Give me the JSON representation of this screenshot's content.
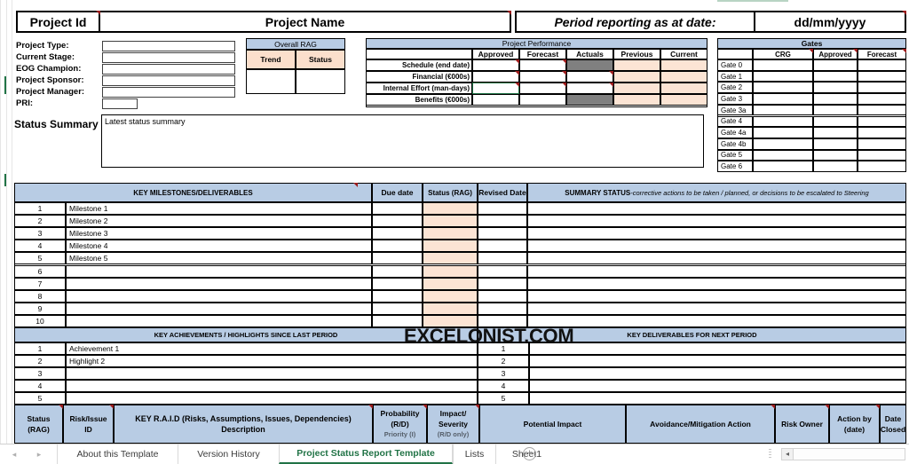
{
  "header": {
    "project_id": "Project Id",
    "project_name": "Project Name",
    "period_label": "Period reporting as at date:",
    "period_value": "dd/mm/yyyy"
  },
  "form": {
    "fields": [
      {
        "label": "Project Type:",
        "value": ""
      },
      {
        "label": "Current Stage:",
        "value": ""
      },
      {
        "label": "EOG Champion:",
        "value": ""
      },
      {
        "label": "Project Sponsor:",
        "value": ""
      },
      {
        "label": "Project Manager:",
        "value": ""
      },
      {
        "label": "PRI:",
        "value": ""
      }
    ]
  },
  "overall_rag": {
    "title": "Overall RAG",
    "columns": [
      "Trend",
      "Status"
    ],
    "values": [
      "",
      ""
    ]
  },
  "project_performance": {
    "title": "Project Performance",
    "columns": [
      "",
      "Approved",
      "Forecast",
      "Actuals",
      "Previous",
      "Current"
    ],
    "rows": [
      {
        "label": "Schedule (end date)",
        "approved": "",
        "forecast": "",
        "actuals": "",
        "previous": "",
        "current": ""
      },
      {
        "label": "Financial (€000s)",
        "approved": "",
        "forecast": "",
        "actuals": "",
        "previous": "",
        "current": ""
      },
      {
        "label": "Internal Effort (man-days)",
        "approved": "",
        "forecast": "",
        "actuals": "",
        "previous": "",
        "current": ""
      },
      {
        "label": "Benefits (€000s)",
        "approved": "",
        "forecast": "",
        "actuals": "",
        "previous": "",
        "current": ""
      }
    ]
  },
  "gates": {
    "title": "Gates",
    "columns": [
      "",
      "CRG",
      "Approved",
      "Forecast"
    ],
    "rows": [
      {
        "label": "Gate 0",
        "crg": "",
        "approved": "",
        "forecast": ""
      },
      {
        "label": "Gate 1",
        "crg": "",
        "approved": "",
        "forecast": ""
      },
      {
        "label": "Gate 2",
        "crg": "",
        "approved": "",
        "forecast": ""
      },
      {
        "label": "Gate 3",
        "crg": "",
        "approved": "",
        "forecast": ""
      },
      {
        "label": "Gate 3a",
        "crg": "",
        "approved": "",
        "forecast": ""
      },
      {
        "label": "Gate 4",
        "crg": "",
        "approved": "",
        "forecast": ""
      },
      {
        "label": "Gate 4a",
        "crg": "",
        "approved": "",
        "forecast": ""
      },
      {
        "label": "Gate 4b",
        "crg": "",
        "approved": "",
        "forecast": ""
      },
      {
        "label": "Gate 5",
        "crg": "",
        "approved": "",
        "forecast": ""
      },
      {
        "label": "Gate 6",
        "crg": "",
        "approved": "",
        "forecast": ""
      }
    ]
  },
  "status_summary": {
    "label": "Status Summary",
    "value": "Latest status summary"
  },
  "milestones": {
    "title": "KEY MILESTONES/DELIVERABLES",
    "col_due": "Due date",
    "col_status": "Status (RAG)",
    "col_revised": "Revised Date",
    "col_summary_bold": "SUMMARY STATUS",
    "col_summary_italic": "-corrective actions to be taken / planned, or decisions to be escalated to Steering",
    "rows": [
      {
        "n": "1",
        "name": "Milestone 1",
        "due": "",
        "status": "",
        "revised": "",
        "summary": ""
      },
      {
        "n": "2",
        "name": "Milestone 2",
        "due": "",
        "status": "",
        "revised": "",
        "summary": ""
      },
      {
        "n": "3",
        "name": "Milestone 3",
        "due": "",
        "status": "",
        "revised": "",
        "summary": ""
      },
      {
        "n": "4",
        "name": "Milestone 4",
        "due": "",
        "status": "",
        "revised": "",
        "summary": ""
      },
      {
        "n": "5",
        "name": "Milestone 5",
        "due": "",
        "status": "",
        "revised": "",
        "summary": ""
      },
      {
        "n": "6",
        "name": "",
        "due": "",
        "status": "",
        "revised": "",
        "summary": ""
      },
      {
        "n": "7",
        "name": "",
        "due": "",
        "status": "",
        "revised": "",
        "summary": ""
      },
      {
        "n": "8",
        "name": "",
        "due": "",
        "status": "",
        "revised": "",
        "summary": ""
      },
      {
        "n": "9",
        "name": "",
        "due": "",
        "status": "",
        "revised": "",
        "summary": ""
      },
      {
        "n": "10",
        "name": "",
        "due": "",
        "status": "",
        "revised": "",
        "summary": ""
      }
    ]
  },
  "achievements": {
    "title_left": "KEY ACHIEVEMENTS / HIGHLIGHTS SINCE LAST PERIOD",
    "title_right": "KEY DELIVERABLES FOR NEXT PERIOD",
    "rows": [
      {
        "n": "1",
        "left": "Achievement 1",
        "rn": "1",
        "right": ""
      },
      {
        "n": "2",
        "left": "Highlight 2",
        "rn": "2",
        "right": ""
      },
      {
        "n": "3",
        "left": "",
        "rn": "3",
        "right": ""
      },
      {
        "n": "4",
        "left": "",
        "rn": "4",
        "right": ""
      },
      {
        "n": "5",
        "left": "",
        "rn": "5",
        "right": ""
      }
    ]
  },
  "raid": {
    "columns": [
      {
        "line1": "Status",
        "line2": "(RAG)"
      },
      {
        "line1": "Risk/Issue",
        "line2": "ID"
      },
      {
        "line1": "KEY R.A.I.D (Risks, Assumptions, Issues, Dependencies)",
        "line2": "Description"
      },
      {
        "line1": "Probability",
        "line2": "(R/D)",
        "line3": "Priority (I)"
      },
      {
        "line1": "Impact/",
        "line2": "Severity",
        "line3": "(R/D only)"
      },
      {
        "line1": "Potential Impact",
        "line2": ""
      },
      {
        "line1": "Avoidance/Mitigation Action",
        "line2": ""
      },
      {
        "line1": "Risk Owner",
        "line2": ""
      },
      {
        "line1": "Action by",
        "line2": "(date)"
      },
      {
        "line1": "Date Closed",
        "line2": ""
      }
    ]
  },
  "watermark": "EXCELONIST.COM",
  "sheet_tabs": {
    "items": [
      {
        "label": "About this Template",
        "active": false
      },
      {
        "label": "Version History",
        "active": false
      },
      {
        "label": "Project Status Report Template",
        "active": true
      },
      {
        "label": "Lists",
        "active": false
      },
      {
        "label": "Sheet1",
        "active": false
      }
    ],
    "add_sheet_label": "+",
    "nav_prev": "◂",
    "nav_next": "▸",
    "scroll_left": "◂"
  },
  "colors": {
    "header_blue": "#b8cce4",
    "rag_peach": "#fbdfcc",
    "status_peach": "#fce4d4",
    "blocked_grey": "#808080",
    "excel_green": "#217346"
  }
}
